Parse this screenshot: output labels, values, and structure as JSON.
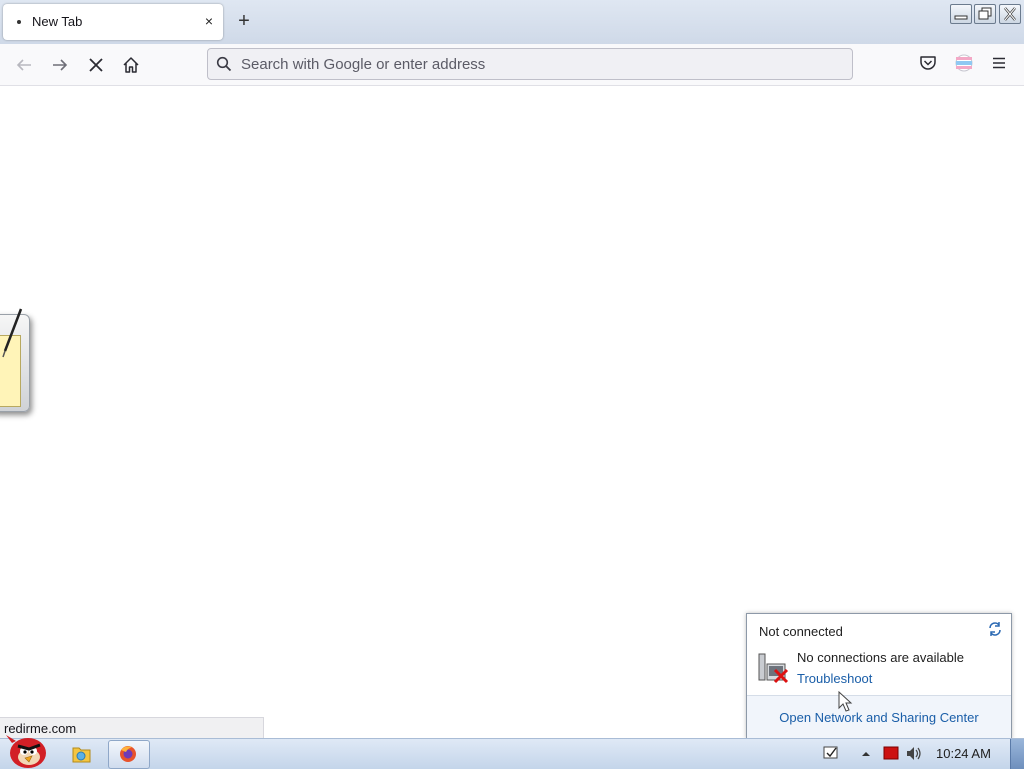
{
  "browser": {
    "tab": {
      "title": "New Tab",
      "close_glyph": "×"
    },
    "new_tab_glyph": "+",
    "urlbar": {
      "placeholder": "Search with Google or enter address",
      "value": ""
    },
    "status_text": "redirme.com",
    "icons": [
      "back-arrow-icon",
      "forward-arrow-icon",
      "stop-icon",
      "home-icon",
      "search-icon",
      "pocket-icon",
      "account-icon",
      "hamburger-menu-icon"
    ]
  },
  "window_controls": [
    "minimize",
    "maximize",
    "close"
  ],
  "network_flyout": {
    "title": "Not connected",
    "message": "No connections are available",
    "troubleshoot_label": "Troubleshoot",
    "open_center_label": "Open Network and Sharing Center"
  },
  "taskbar": {
    "clock": "10:24 AM",
    "items": [
      "start-button",
      "windows-explorer",
      "firefox"
    ]
  },
  "colors": {
    "link": "#1a5ea8",
    "taskbar": "#c4d5ea",
    "tray_network_error": "#cc1111"
  }
}
